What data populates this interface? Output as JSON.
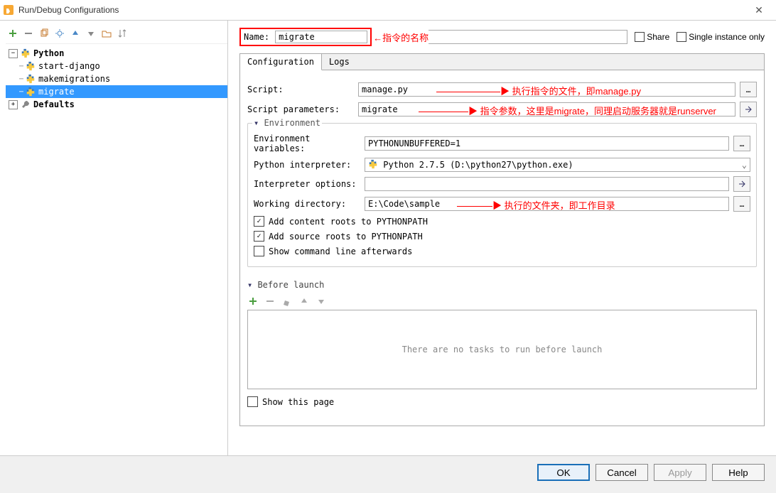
{
  "title": "Run/Debug Configurations",
  "tree": {
    "python_label": "Python",
    "items": [
      "start-django",
      "makemigrations",
      "migrate"
    ],
    "selected_index": 2,
    "defaults_label": "Defaults"
  },
  "name_label": "Name:",
  "name_value": "migrate",
  "name_annotation": "←指令的名称",
  "share": "Share",
  "single_instance": "Single instance only",
  "tabs": {
    "config": "Configuration",
    "logs": "Logs"
  },
  "fields": {
    "script_label": "Script:",
    "script_value": "manage.py",
    "script_note": "执行指令的文件，即manage.py",
    "params_label": "Script parameters:",
    "params_value": "migrate",
    "params_note": "指令参数，这里是migrate，同理启动服务器就是runserver",
    "env_legend": "Environment",
    "envvars_label": "Environment variables:",
    "envvars_value": "PYTHONUNBUFFERED=1",
    "interp_label": "Python interpreter:",
    "interp_value": "Python 2.7.5 (D:\\python27\\python.exe)",
    "interpopt_label": "Interpreter options:",
    "interpopt_value": "",
    "wd_label": "Working directory:",
    "wd_value": "E:\\Code\\sample",
    "wd_note": "执行的文件夹，即工作目录",
    "cb_content": "Add content roots to PYTHONPATH",
    "cb_source": "Add source roots to PYTHONPATH",
    "cb_cmdline": "Show command line afterwards"
  },
  "before_launch": {
    "legend": "Before launch",
    "empty": "There are no tasks to run before launch",
    "show_page": "Show this page"
  },
  "buttons": {
    "ok": "OK",
    "cancel": "Cancel",
    "apply": "Apply",
    "help": "Help"
  }
}
